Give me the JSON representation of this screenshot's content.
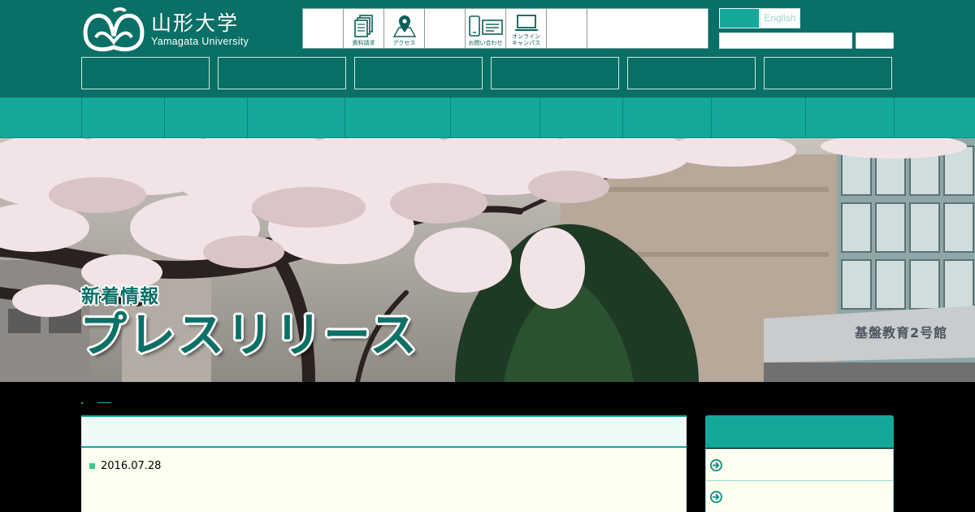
{
  "header": {
    "logo_jp": "山形大学",
    "logo_en": "Yamagata University",
    "utility_nav": [
      {
        "label": "",
        "icon": ""
      },
      {
        "label": "資料請求",
        "icon": "document-stack-icon"
      },
      {
        "label": "アクセス",
        "icon": "map-pin-icon"
      },
      {
        "label": "",
        "icon": ""
      },
      {
        "label": "お問い合わせ",
        "icon": "phone-mail-icon"
      },
      {
        "label": "オンライン\nキャンパス",
        "icon": "laptop-icon"
      },
      {
        "label": "",
        "icon": ""
      },
      {
        "label": "",
        "icon": ""
      }
    ],
    "lang_en": "English",
    "search_placeholder": ""
  },
  "hero": {
    "subtitle": "新着情報",
    "title": "プレスリリース",
    "building_sign": "基盤教育2号館"
  },
  "main": {
    "date": "2016.07.28"
  },
  "colors": {
    "header_bg": "#0a6f66",
    "nav_bg": "#14a89b",
    "panel_bg": "#fdfff1",
    "bullet": "#3cc88a"
  }
}
